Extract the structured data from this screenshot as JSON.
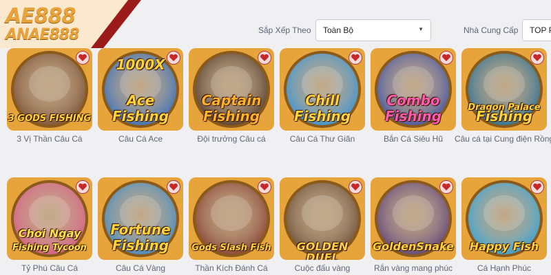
{
  "brand": {
    "line1": "AE888",
    "line2": "ANAE888"
  },
  "filters": {
    "sort_label": "Sắp Xếp Theo",
    "sort_value": "Toàn Bộ",
    "provider_label": "Nhà Cung Cấp",
    "provider_value": "TOP PL"
  },
  "colors": {
    "heart": "#c62828",
    "thumb_gold": "#e6a43a",
    "label_text": "#5f6675"
  },
  "games": [
    {
      "title": "3 Vị Thần Câu Cá",
      "art_text": [
        "3 GODS FISHING"
      ],
      "icon": "three-gods-art",
      "bg": "#6b3a1c",
      "art_color": "#ffd23a"
    },
    {
      "title": "Câu Cá Ace",
      "art_text": [
        "1000X",
        "Ace",
        "Fishing"
      ],
      "icon": "shark-art",
      "bg": "#1d5fb7",
      "art_color": "#ffd23a"
    },
    {
      "title": "Đội trưởng Câu cá",
      "art_text": [
        "Captain",
        "Fishing"
      ],
      "icon": "pirate-skull-art",
      "bg": "#3e2414",
      "art_color": "#ffb12a"
    },
    {
      "title": "Câu Cá Thư Giãn",
      "art_text": [
        "Chill",
        "Fishing"
      ],
      "icon": "blue-shark-art",
      "bg": "#1e88d4",
      "art_color": "#ffd23a"
    },
    {
      "title": "Bắn Cá Siêu Hũ",
      "art_text": [
        "Combo",
        "Fishing"
      ],
      "icon": "robot-fish-art",
      "bg": "#2a3f9e",
      "art_color": "#ff5ab0"
    },
    {
      "title": "Câu cá tại Cung điện Rồng",
      "art_text": [
        "Dragon Palace",
        "Fishing"
      ],
      "icon": "dragon-palace-art",
      "bg": "#0d5f8c",
      "art_color": "#ffd23a"
    },
    {
      "title": "Tỷ Phú Câu Cá",
      "art_text": [
        "Chơi Ngay",
        "Fishing Tycoon"
      ],
      "icon": "tycoon-shark-art",
      "bg": "#d64a7a",
      "art_color": "#ffe14a"
    },
    {
      "title": "Câu Cá Vàng",
      "art_text": [
        "Fortune",
        "Fishing"
      ],
      "icon": "fortune-god-art",
      "bg": "#2b7fc2",
      "art_color": "#ffd23a"
    },
    {
      "title": "Thần Kích Đánh Cá",
      "art_text": [
        "Gods Slash Fish"
      ],
      "icon": "gods-slash-art",
      "bg": "#7a2a18",
      "art_color": "#ffd23a"
    },
    {
      "title": "Cuộc đấu vàng",
      "art_text": [
        "GOLDEN DUEL"
      ],
      "icon": "cowgirl-art",
      "bg": "#5b3a22",
      "art_color": "#ffcf4a"
    },
    {
      "title": "Rắn vàng mang phúc",
      "art_text": [
        "GoldenSnake"
      ],
      "icon": "golden-snake-art",
      "bg": "#4b2c6e",
      "art_color": "#ffd23a"
    },
    {
      "title": "Cá Hạnh Phúc",
      "art_text": [
        "Happy Fish"
      ],
      "icon": "happy-fish-art",
      "bg": "#1a9ad6",
      "art_color": "#ffd23a"
    }
  ]
}
